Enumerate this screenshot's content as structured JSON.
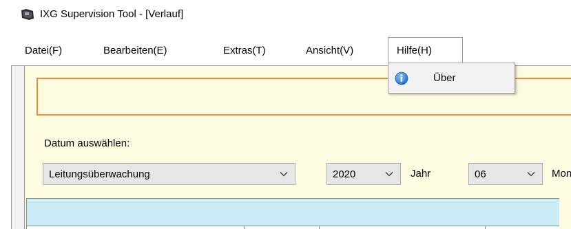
{
  "window": {
    "title": "IXG Supervision Tool - [Verlauf]",
    "icon": "app-icon"
  },
  "menubar": {
    "items": [
      {
        "label": "Datei(F)"
      },
      {
        "label": "Bearbeiten(E)"
      },
      {
        "label": "Extras(T)"
      },
      {
        "label": "Ansicht(V)"
      },
      {
        "label": "Hilfe(H)",
        "active": true
      }
    ]
  },
  "help_menu": {
    "items": [
      {
        "label": "Über",
        "icon": "info-icon"
      }
    ]
  },
  "main": {
    "date_label": "Datum auswählen:",
    "type_select": {
      "value": "Leitungsüberwachung"
    },
    "year_select": {
      "value": "2020"
    },
    "year_label": "Jahr",
    "month_select": {
      "value": "06"
    },
    "month_label": "Mon"
  },
  "colors": {
    "accent_border": "#f0893c",
    "panel_bg": "#fdfbe0",
    "table_header_bg": "#c9ecf5",
    "info_icon": "#2f7ed8"
  }
}
